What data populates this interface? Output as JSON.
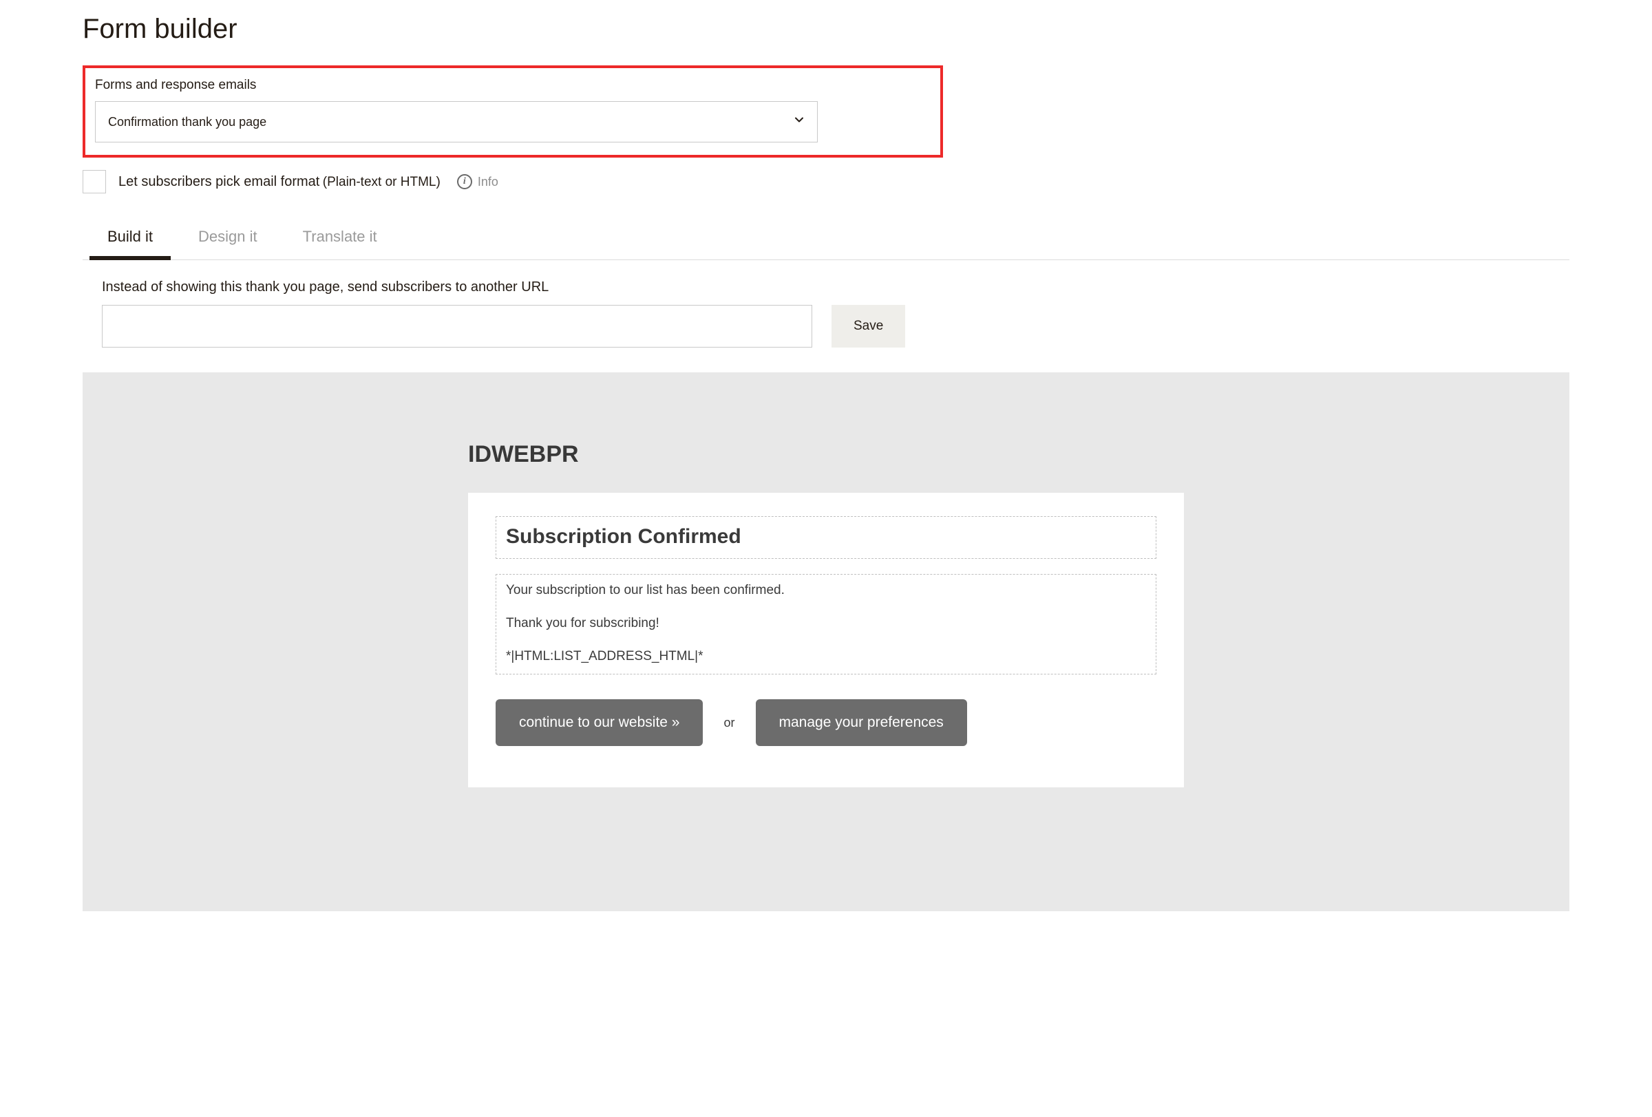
{
  "pageTitle": "Form builder",
  "formsSection": {
    "label": "Forms and response emails",
    "selectedOption": "Confirmation thank you page"
  },
  "checkbox": {
    "labelMain": "Let subscribers pick email format",
    "labelSub": "(Plain-text or HTML)",
    "infoText": "Info"
  },
  "tabs": [
    "Build it",
    "Design it",
    "Translate it"
  ],
  "activeTab": 0,
  "redirect": {
    "label": "Instead of showing this thank you page, send subscribers to another URL",
    "value": "",
    "saveLabel": "Save"
  },
  "preview": {
    "brand": "IDWEBPR",
    "confirmTitle": "Subscription Confirmed",
    "bodyLine1": "Your subscription to our list has been confirmed.",
    "bodyLine2": "Thank you for subscribing!",
    "bodyLine3": "*|HTML:LIST_ADDRESS_HTML|*",
    "btnContinue": "continue to our website »",
    "orText": "or",
    "btnManage": "manage your preferences"
  }
}
